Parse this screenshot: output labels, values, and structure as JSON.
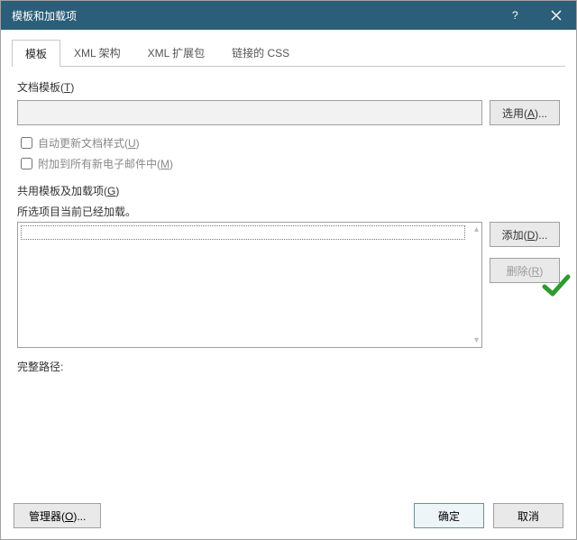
{
  "titlebar": {
    "title": "模板和加载项"
  },
  "tabs": [
    {
      "label": "模板",
      "active": true
    },
    {
      "label": "XML 架构",
      "active": false
    },
    {
      "label": "XML 扩展包",
      "active": false
    },
    {
      "label": "链接的 CSS",
      "active": false
    }
  ],
  "doc_template": {
    "label_prefix": "文档模板(",
    "label_key": "T",
    "label_suffix": ")",
    "value": "",
    "select_btn_prefix": "选用(",
    "select_btn_key": "A",
    "select_btn_suffix": ")..."
  },
  "auto_update": {
    "label_prefix": "自动更新文档样式(",
    "label_key": "U",
    "label_suffix": ")",
    "checked": false
  },
  "attach_mail": {
    "label_prefix": "附加到所有新电子邮件中(",
    "label_key": "M",
    "label_suffix": ")",
    "checked": false
  },
  "shared": {
    "label_prefix": "共用模板及加载项(",
    "label_key": "G",
    "label_suffix": ")",
    "status": "所选项目当前已经加载。",
    "add_btn_prefix": "添加(",
    "add_btn_key": "D",
    "add_btn_suffix": ")...",
    "remove_btn_prefix": "删除(",
    "remove_btn_key": "R",
    "remove_btn_suffix": ")"
  },
  "fullpath_label": "完整路径:",
  "footer": {
    "manager_prefix": "管理器(",
    "manager_key": "O",
    "manager_suffix": ")...",
    "ok": "确定",
    "cancel": "取消"
  }
}
